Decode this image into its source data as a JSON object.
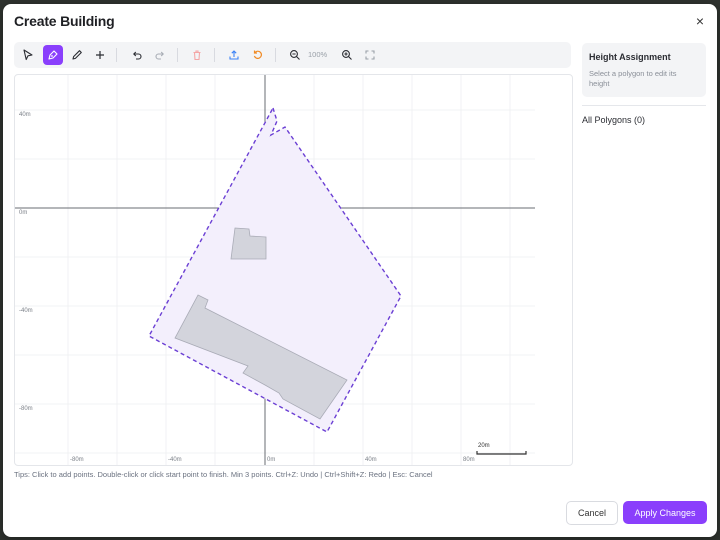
{
  "dialog": {
    "title": "Create Building",
    "close": "×"
  },
  "toolbar": {
    "zoom_level": "100%"
  },
  "canvas": {
    "x_labels": [
      "-80m",
      "-40m",
      "0m",
      "40m",
      "80m"
    ],
    "y_labels": [
      "40m",
      "0m",
      "-40m",
      "-80m"
    ],
    "scale_label": "20m"
  },
  "tips": "Tips: Click to add points. Double-click or click start point to finish. Min 3 points.   Ctrl+Z: Undo | Ctrl+Shift+Z: Redo | Esc: Cancel",
  "panel": {
    "title": "Height Assignment",
    "subtitle": "Select a polygon to edit its height",
    "all_polygons": "All Polygons (0)"
  },
  "footer": {
    "cancel": "Cancel",
    "apply": "Apply Changes"
  },
  "colors": {
    "accent": "#8a3ffc",
    "polygon_fill": "#f3effc",
    "building_fill": "#d3d4dc"
  }
}
